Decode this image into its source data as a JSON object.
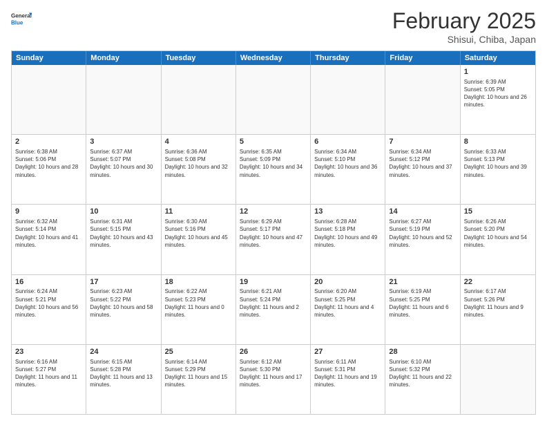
{
  "header": {
    "logo_general": "General",
    "logo_blue": "Blue",
    "title": "February 2025",
    "location": "Shisui, Chiba, Japan"
  },
  "weekdays": [
    "Sunday",
    "Monday",
    "Tuesday",
    "Wednesday",
    "Thursday",
    "Friday",
    "Saturday"
  ],
  "rows": [
    [
      {
        "day": "",
        "text": ""
      },
      {
        "day": "",
        "text": ""
      },
      {
        "day": "",
        "text": ""
      },
      {
        "day": "",
        "text": ""
      },
      {
        "day": "",
        "text": ""
      },
      {
        "day": "",
        "text": ""
      },
      {
        "day": "1",
        "text": "Sunrise: 6:39 AM\nSunset: 5:05 PM\nDaylight: 10 hours and 26 minutes."
      }
    ],
    [
      {
        "day": "2",
        "text": "Sunrise: 6:38 AM\nSunset: 5:06 PM\nDaylight: 10 hours and 28 minutes."
      },
      {
        "day": "3",
        "text": "Sunrise: 6:37 AM\nSunset: 5:07 PM\nDaylight: 10 hours and 30 minutes."
      },
      {
        "day": "4",
        "text": "Sunrise: 6:36 AM\nSunset: 5:08 PM\nDaylight: 10 hours and 32 minutes."
      },
      {
        "day": "5",
        "text": "Sunrise: 6:35 AM\nSunset: 5:09 PM\nDaylight: 10 hours and 34 minutes."
      },
      {
        "day": "6",
        "text": "Sunrise: 6:34 AM\nSunset: 5:10 PM\nDaylight: 10 hours and 36 minutes."
      },
      {
        "day": "7",
        "text": "Sunrise: 6:34 AM\nSunset: 5:12 PM\nDaylight: 10 hours and 37 minutes."
      },
      {
        "day": "8",
        "text": "Sunrise: 6:33 AM\nSunset: 5:13 PM\nDaylight: 10 hours and 39 minutes."
      }
    ],
    [
      {
        "day": "9",
        "text": "Sunrise: 6:32 AM\nSunset: 5:14 PM\nDaylight: 10 hours and 41 minutes."
      },
      {
        "day": "10",
        "text": "Sunrise: 6:31 AM\nSunset: 5:15 PM\nDaylight: 10 hours and 43 minutes."
      },
      {
        "day": "11",
        "text": "Sunrise: 6:30 AM\nSunset: 5:16 PM\nDaylight: 10 hours and 45 minutes."
      },
      {
        "day": "12",
        "text": "Sunrise: 6:29 AM\nSunset: 5:17 PM\nDaylight: 10 hours and 47 minutes."
      },
      {
        "day": "13",
        "text": "Sunrise: 6:28 AM\nSunset: 5:18 PM\nDaylight: 10 hours and 49 minutes."
      },
      {
        "day": "14",
        "text": "Sunrise: 6:27 AM\nSunset: 5:19 PM\nDaylight: 10 hours and 52 minutes."
      },
      {
        "day": "15",
        "text": "Sunrise: 6:26 AM\nSunset: 5:20 PM\nDaylight: 10 hours and 54 minutes."
      }
    ],
    [
      {
        "day": "16",
        "text": "Sunrise: 6:24 AM\nSunset: 5:21 PM\nDaylight: 10 hours and 56 minutes."
      },
      {
        "day": "17",
        "text": "Sunrise: 6:23 AM\nSunset: 5:22 PM\nDaylight: 10 hours and 58 minutes."
      },
      {
        "day": "18",
        "text": "Sunrise: 6:22 AM\nSunset: 5:23 PM\nDaylight: 11 hours and 0 minutes."
      },
      {
        "day": "19",
        "text": "Sunrise: 6:21 AM\nSunset: 5:24 PM\nDaylight: 11 hours and 2 minutes."
      },
      {
        "day": "20",
        "text": "Sunrise: 6:20 AM\nSunset: 5:25 PM\nDaylight: 11 hours and 4 minutes."
      },
      {
        "day": "21",
        "text": "Sunrise: 6:19 AM\nSunset: 5:25 PM\nDaylight: 11 hours and 6 minutes."
      },
      {
        "day": "22",
        "text": "Sunrise: 6:17 AM\nSunset: 5:26 PM\nDaylight: 11 hours and 9 minutes."
      }
    ],
    [
      {
        "day": "23",
        "text": "Sunrise: 6:16 AM\nSunset: 5:27 PM\nDaylight: 11 hours and 11 minutes."
      },
      {
        "day": "24",
        "text": "Sunrise: 6:15 AM\nSunset: 5:28 PM\nDaylight: 11 hours and 13 minutes."
      },
      {
        "day": "25",
        "text": "Sunrise: 6:14 AM\nSunset: 5:29 PM\nDaylight: 11 hours and 15 minutes."
      },
      {
        "day": "26",
        "text": "Sunrise: 6:12 AM\nSunset: 5:30 PM\nDaylight: 11 hours and 17 minutes."
      },
      {
        "day": "27",
        "text": "Sunrise: 6:11 AM\nSunset: 5:31 PM\nDaylight: 11 hours and 19 minutes."
      },
      {
        "day": "28",
        "text": "Sunrise: 6:10 AM\nSunset: 5:32 PM\nDaylight: 11 hours and 22 minutes."
      },
      {
        "day": "",
        "text": ""
      }
    ]
  ]
}
